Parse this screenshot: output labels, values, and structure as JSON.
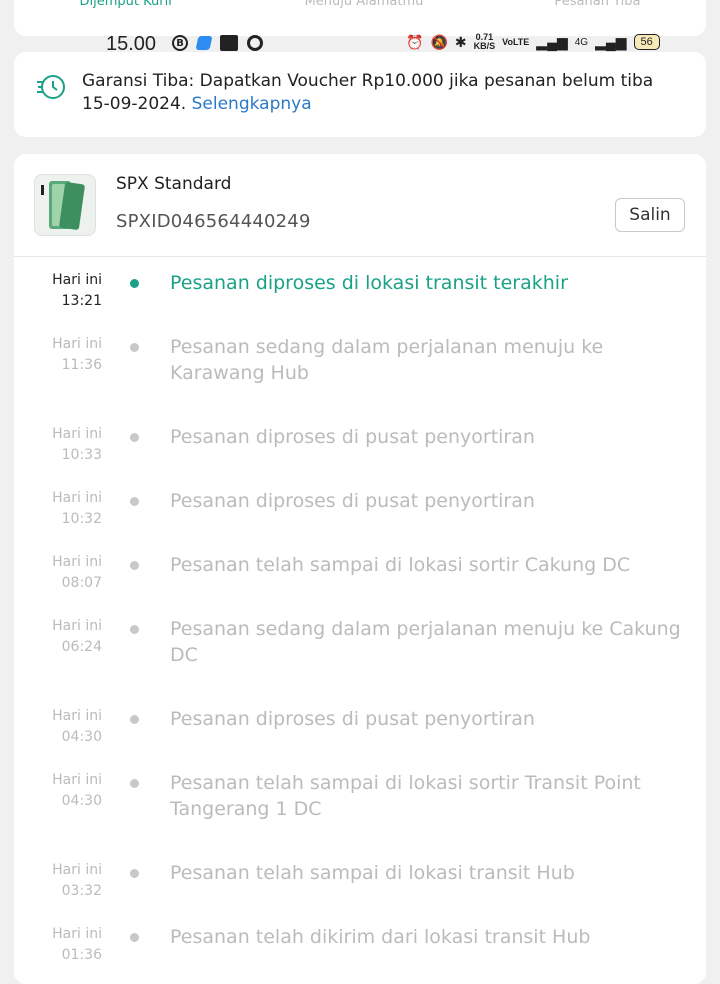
{
  "top_tabs": [
    "Dijemput Kurir",
    "Menuju Alamatmu",
    "Pesanan Tiba"
  ],
  "status_bar": {
    "time": "15.00",
    "speed_value": "0.71",
    "speed_unit": "KB/S",
    "volte": "VoLTE",
    "network": "4G",
    "battery": "56"
  },
  "guarantee": {
    "text": "Garansi Tiba: Dapatkan Voucher Rp10.000 jika pesanan belum tiba 15-09-2024. ",
    "link": "Selengkapnya"
  },
  "shipment": {
    "courier": "SPX Standard",
    "tracking_number": "SPXID046564440249",
    "copy_label": "Salin"
  },
  "events": [
    {
      "day": "Hari ini",
      "time": "13:21",
      "desc": "Pesanan diproses di lokasi transit terakhir",
      "active": true
    },
    {
      "day": "Hari ini",
      "time": "11:36",
      "desc": "Pesanan sedang dalam perjalanan  menuju ke Karawang Hub",
      "active": false
    },
    {
      "day": "Hari ini",
      "time": "10:33",
      "desc": "Pesanan diproses di pusat penyortiran",
      "active": false
    },
    {
      "day": "Hari ini",
      "time": "10:32",
      "desc": "Pesanan diproses di pusat penyortiran",
      "active": false
    },
    {
      "day": "Hari ini",
      "time": "08:07",
      "desc": "Pesanan telah sampai di lokasi sortir Cakung DC",
      "active": false
    },
    {
      "day": "Hari ini",
      "time": "06:24",
      "desc": "Pesanan sedang dalam perjalanan  menuju ke Cakung DC",
      "active": false
    },
    {
      "day": "Hari ini",
      "time": "04:30",
      "desc": "Pesanan diproses di pusat penyortiran",
      "active": false
    },
    {
      "day": "Hari ini",
      "time": "04:30",
      "desc": "Pesanan telah sampai di lokasi sortir Transit Point Tangerang 1 DC",
      "active": false
    },
    {
      "day": "Hari ini",
      "time": "03:32",
      "desc": "Pesanan telah sampai di lokasi transit Hub",
      "active": false
    },
    {
      "day": "Hari ini",
      "time": "01:36",
      "desc": "Pesanan telah dikirim dari lokasi transit Hub",
      "active": false
    }
  ],
  "colors": {
    "accent": "#1aa187",
    "link": "#2b79c9",
    "muted": "#bbbbbb"
  },
  "icons": [
    "clock-delivery-icon",
    "phone-product-thumbnail"
  ]
}
